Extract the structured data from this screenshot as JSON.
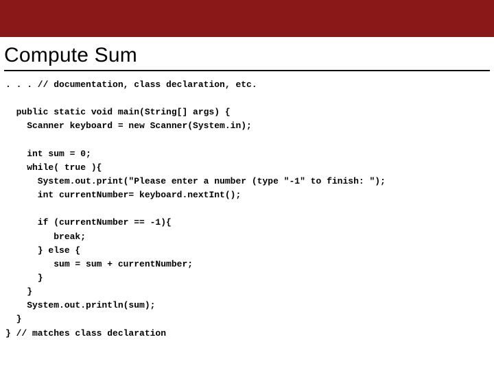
{
  "slide": {
    "title": "Compute Sum",
    "code": ". . . // documentation, class declaration, etc.\n\n  public static void main(String[] args) {\n    Scanner keyboard = new Scanner(System.in);\n\n    int sum = 0;\n    while( true ){\n      System.out.print(\"Please enter a number (type \"-1\" to finish: \");\n      int currentNumber= keyboard.nextInt();\n\n      if (currentNumber == -1){\n         break;\n      } else {\n         sum = sum + currentNumber;\n      }\n    }\n    System.out.println(sum);\n  }\n} // matches class declaration"
  }
}
